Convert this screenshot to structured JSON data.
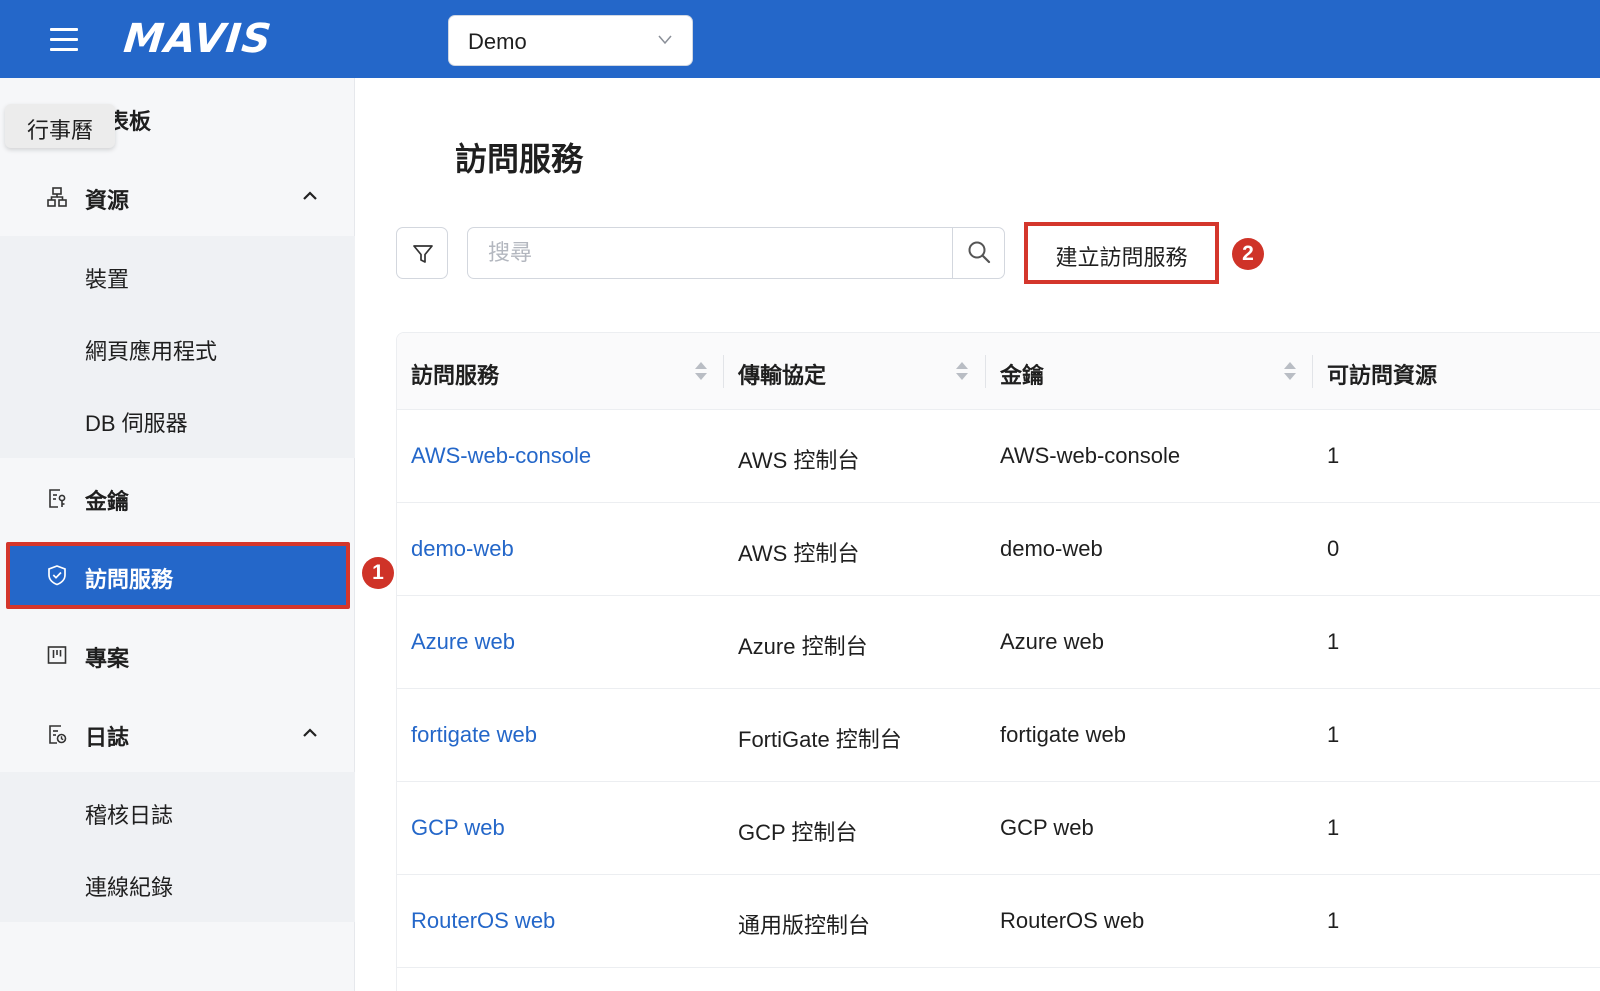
{
  "header": {
    "logo": "MAVIS",
    "tenant_select": {
      "value": "Demo"
    }
  },
  "sidebar": {
    "tooltip": "行事曆",
    "dashboard_label": "儀表板",
    "resources": {
      "label": "資源",
      "expanded": true,
      "items": [
        {
          "label": "裝置"
        },
        {
          "label": "網頁應用程式"
        },
        {
          "label": "DB 伺服器"
        }
      ]
    },
    "keys": {
      "label": "金鑰"
    },
    "access_services": {
      "label": "訪問服務",
      "active": true
    },
    "projects": {
      "label": "專案"
    },
    "logs": {
      "label": "日誌",
      "expanded": true,
      "items": [
        {
          "label": "稽核日誌"
        },
        {
          "label": "連線紀錄"
        }
      ]
    }
  },
  "annotations": {
    "badge_1": "1",
    "badge_2": "2"
  },
  "main": {
    "title": "訪問服務",
    "search": {
      "placeholder": "搜尋",
      "value": ""
    },
    "create_button": "建立訪問服務",
    "table": {
      "columns": [
        "訪問服務",
        "傳輸協定",
        "金鑰",
        "可訪問資源"
      ],
      "rows": [
        {
          "name": "AWS-web-console",
          "protocol": "AWS 控制台",
          "key": "AWS-web-console",
          "resources": "1"
        },
        {
          "name": "demo-web",
          "protocol": "AWS 控制台",
          "key": "demo-web",
          "resources": "0"
        },
        {
          "name": "Azure web",
          "protocol": "Azure 控制台",
          "key": "Azure web",
          "resources": "1"
        },
        {
          "name": "fortigate web",
          "protocol": "FortiGate 控制台",
          "key": "fortigate web",
          "resources": "1"
        },
        {
          "name": "GCP web",
          "protocol": "GCP 控制台",
          "key": "GCP web",
          "resources": "1"
        },
        {
          "name": "RouterOS web",
          "protocol": "通用版控制台",
          "key": "RouterOS web",
          "resources": "1"
        }
      ]
    }
  },
  "colors": {
    "brand": "#2467c9",
    "highlight": "#d4362c",
    "link": "#2467c9",
    "badge": "#cf3328"
  }
}
